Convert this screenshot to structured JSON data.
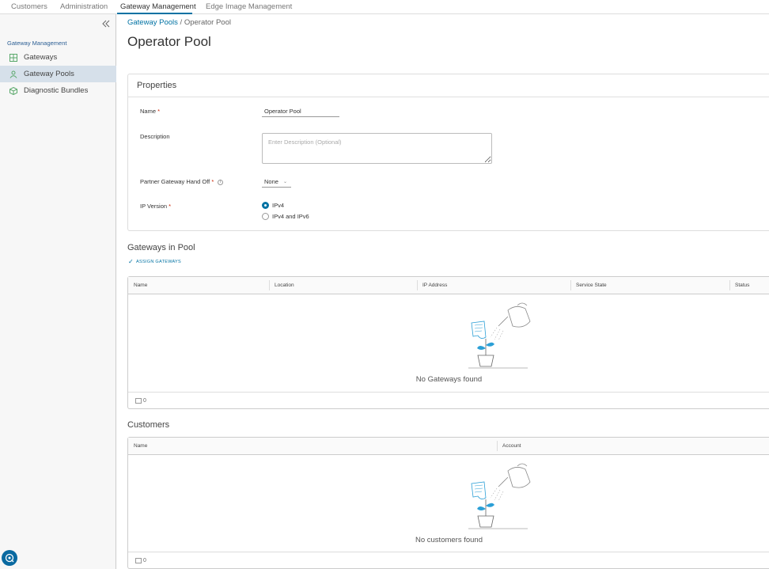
{
  "topnav": {
    "tabs": [
      "Customers",
      "Administration",
      "Gateway Management",
      "Edge Image Management"
    ],
    "active_tab": "Gateway Management"
  },
  "sidebar": {
    "heading": "Gateway Management",
    "items": [
      {
        "label": "Gateways",
        "icon": "gateways-icon"
      },
      {
        "label": "Gateway Pools",
        "icon": "gateway-pools-icon",
        "active": true
      },
      {
        "label": "Diagnostic Bundles",
        "icon": "diagnostic-bundles-icon"
      }
    ],
    "collapse_icon": "double-chevron-left-icon"
  },
  "breadcrumb": {
    "parent": "Gateway Pools",
    "separator": "/",
    "current": "Operator Pool"
  },
  "page_title": "Operator Pool",
  "properties": {
    "title": "Properties",
    "name_label": "Name",
    "name_value": "Operator Pool",
    "description_label": "Description",
    "description_placeholder": "Enter Description (Optional)",
    "handoff_label": "Partner Gateway Hand Off",
    "handoff_value": "None",
    "ip_version_label": "IP Version",
    "ip_options": [
      "IPv4",
      "IPv4 and IPv6"
    ],
    "ip_selected": "IPv4",
    "required_marker": "*"
  },
  "gateways_section": {
    "title": "Gateways in Pool",
    "assign_label": "ASSIGN GATEWAYS",
    "columns": [
      "Name",
      "Location",
      "IP Address",
      "Service State",
      "Status"
    ],
    "empty_text": "No Gateways found",
    "footer_count": "0"
  },
  "customers_section": {
    "title": "Customers",
    "columns": [
      "Name",
      "Account"
    ],
    "empty_text": "No customers found",
    "footer_count": "0"
  },
  "colors": {
    "accent": "#0072a3",
    "sidebar_active": "#d6e0ea",
    "plant_blue": "#2b9fd6"
  }
}
